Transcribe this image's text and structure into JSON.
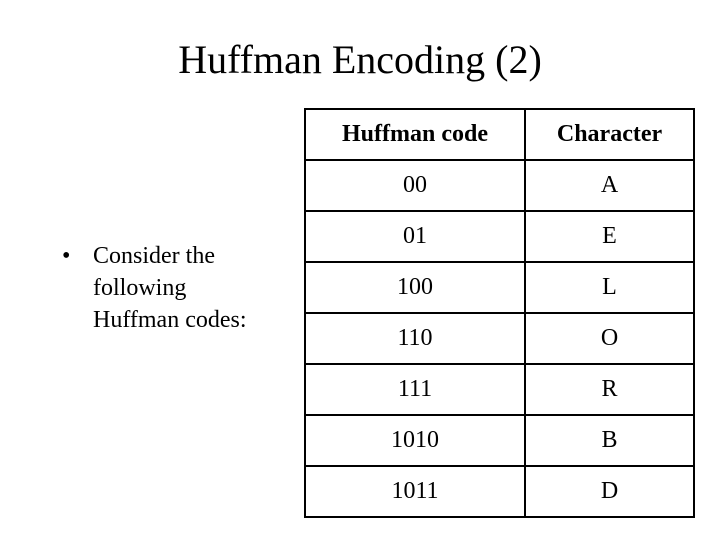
{
  "title": "Huffman Encoding (2)",
  "bullet": {
    "marker": "•",
    "text": "Consider the following Huffman codes:"
  },
  "table": {
    "headers": [
      "Huffman code",
      "Character"
    ],
    "rows": [
      [
        "00",
        "A"
      ],
      [
        "01",
        "E"
      ],
      [
        "100",
        "L"
      ],
      [
        "110",
        "O"
      ],
      [
        "111",
        "R"
      ],
      [
        "1010",
        "B"
      ],
      [
        "1011",
        "D"
      ]
    ]
  }
}
